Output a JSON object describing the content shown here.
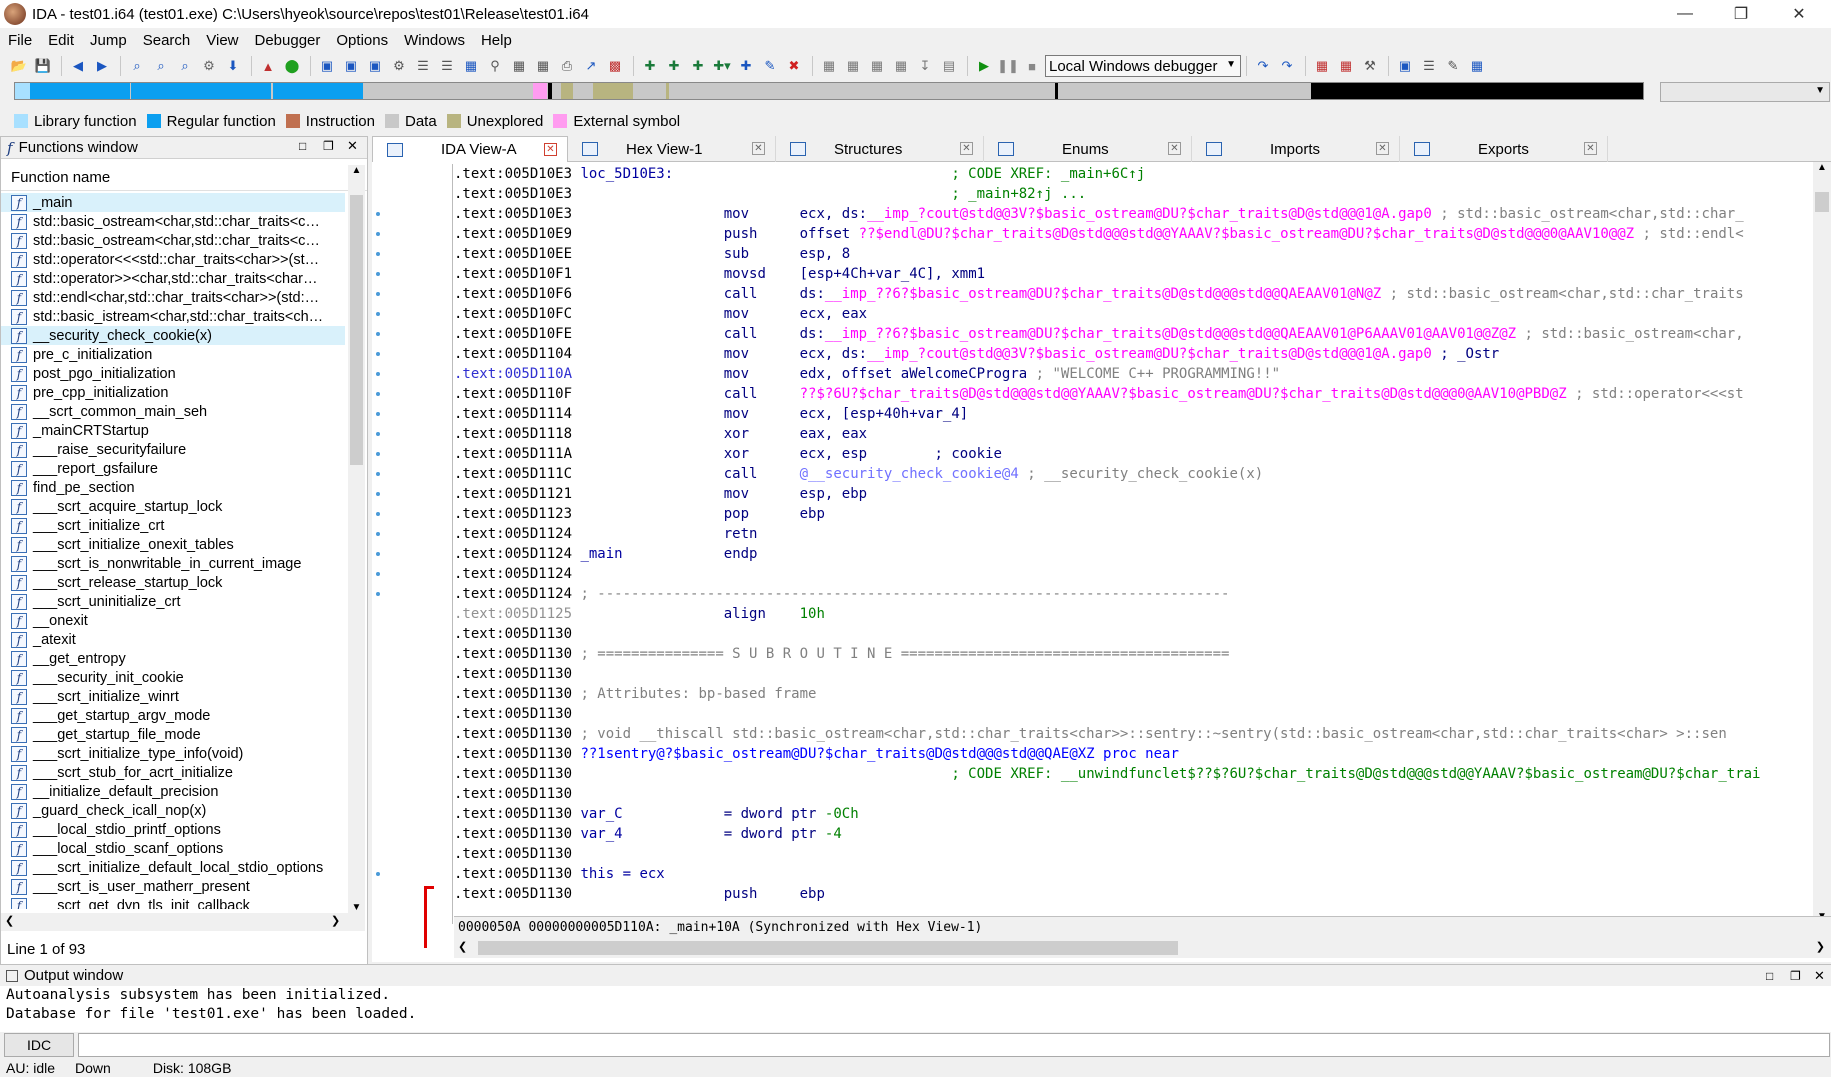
{
  "window": {
    "title": "IDA - test01.i64 (test01.exe) C:\\Users\\hyeok\\source\\repos\\test01\\Release\\test01.i64"
  },
  "menu": [
    "File",
    "Edit",
    "Jump",
    "Search",
    "View",
    "Debugger",
    "Options",
    "Windows",
    "Help"
  ],
  "toolbar": {
    "debugger_select": "Local Windows debugger"
  },
  "legend": [
    {
      "label": "Library function",
      "color": "#a8e0ff"
    },
    {
      "label": "Regular function",
      "color": "#0b9ff0"
    },
    {
      "label": "Instruction",
      "color": "#c07050"
    },
    {
      "label": "Data",
      "color": "#c8c8c8"
    },
    {
      "label": "Unexplored",
      "color": "#b8b480"
    },
    {
      "label": "External symbol",
      "color": "#ff9cf0"
    }
  ],
  "functions_window": {
    "title": "Functions window",
    "column": "Function name",
    "items": [
      "_main",
      "std::basic_ostream<char,std::char_traits<c…",
      "std::basic_ostream<char,std::char_traits<c…",
      "std::operator<<<std::char_traits<char>>(st…",
      "std::operator>><char,std::char_traits<char…",
      "std::endl<char,std::char_traits<char>>(std:…",
      "std::basic_istream<char,std::char_traits<ch…",
      "__security_check_cookie(x)",
      "pre_c_initialization",
      "post_pgo_initialization",
      "pre_cpp_initialization",
      "__scrt_common_main_seh",
      "_mainCRTStartup",
      "___raise_securityfailure",
      "___report_gsfailure",
      "find_pe_section",
      "___scrt_acquire_startup_lock",
      "___scrt_initialize_crt",
      "___scrt_initialize_onexit_tables",
      "___scrt_is_nonwritable_in_current_image",
      "___scrt_release_startup_lock",
      "___scrt_uninitialize_crt",
      "__onexit",
      "_atexit",
      "__get_entropy",
      "___security_init_cookie",
      "___scrt_initialize_winrt",
      "___get_startup_argv_mode",
      "___get_startup_file_mode",
      "___scrt_initialize_type_info(void)",
      "___scrt_stub_for_acrt_initialize",
      "__initialize_default_precision",
      "_guard_check_icall_nop(x)",
      "___local_stdio_printf_options",
      "___local_stdio_scanf_options",
      "___scrt_initialize_default_local_stdio_options",
      "___scrt_is_user_matherr_present",
      "___scrt_get_dyn_tls_init_callback"
    ],
    "status": "Line 1 of 93"
  },
  "tabs": [
    "IDA View-A",
    "Hex View-1",
    "Structures",
    "Enums",
    "Imports",
    "Exports"
  ],
  "code": [
    {
      "addr": ".text:005D10E3",
      "label": "loc_5D10E3:",
      "cmt": "; CODE XREF: _main+6C↑j"
    },
    {
      "addr": ".text:005D10E3",
      "cmt": "; _main+82↑j ..."
    },
    {
      "addr": ".text:005D10E3",
      "mn": "mov",
      "op": "ecx, ds:",
      "sym": "__imp_?cout@std@@3V?$basic_ostream@DU?$char_traits@D@std@@@1@A.gap0",
      "cmt2": " ; std::basic_ostream<char,std::char_"
    },
    {
      "addr": ".text:005D10E9",
      "mn": "push",
      "op": "offset ",
      "sym": "??$endl@DU?$char_traits@D@std@@@std@@YAAAV?$basic_ostream@DU?$char_traits@D@std@@@0@AAV10@@Z",
      "cmt2": " ; std::endl<"
    },
    {
      "addr": ".text:005D10EE",
      "mn": "sub",
      "op": "esp, 8"
    },
    {
      "addr": ".text:005D10F1",
      "mn": "movsd",
      "op": "[esp+4Ch+var_4C], xmm1"
    },
    {
      "addr": ".text:005D10F6",
      "mn": "call",
      "op": "ds:",
      "sym": "__imp_??6?$basic_ostream@DU?$char_traits@D@std@@@std@@QAEAAV01@N@Z",
      "cmt2": " ; std::basic_ostream<char,std::char_traits"
    },
    {
      "addr": ".text:005D10FC",
      "mn": "mov",
      "op": "ecx, eax"
    },
    {
      "addr": ".text:005D10FE",
      "mn": "call",
      "op": "ds:",
      "sym": "__imp_??6?$basic_ostream@DU?$char_traits@D@std@@@std@@QAEAAV01@P6AAAV01@AAV01@@Z@Z",
      "cmt2": " ; std::basic_ostream<char,"
    },
    {
      "addr": ".text:005D1104",
      "mn": "mov",
      "op": "ecx, ds:",
      "sym": "__imp_?cout@std@@3V?$basic_ostream@DU?$char_traits@D@std@@@1@A.gap0",
      "tail": " ; _Ostr"
    },
    {
      "addr": ".text:005D110A",
      "blue": true,
      "mn": "mov",
      "op": "edx, offset aWelcomeCProgra",
      "cmt2": " ; \"WELCOME C++ PROGRAMMING!!\""
    },
    {
      "addr": ".text:005D110F",
      "mn": "call",
      "sym": "??$?6U?$char_traits@D@std@@@std@@YAAAV?$basic_ostream@DU?$char_traits@D@std@@@0@AAV10@PBD@Z",
      "cmt2": " ; std::operator<<<st"
    },
    {
      "addr": ".text:005D1114",
      "mn": "mov",
      "op": "ecx, [esp+40h+var_4]"
    },
    {
      "addr": ".text:005D1118",
      "mn": "xor",
      "op": "eax, eax"
    },
    {
      "addr": ".text:005D111A",
      "mn": "xor",
      "op": "ecx, esp",
      "tail": "        ; cookie"
    },
    {
      "addr": ".text:005D111C",
      "mn": "call",
      "pu": "@__security_check_cookie@4",
      "cmt2": " ; __security_check_cookie(x)"
    },
    {
      "addr": ".text:005D1121",
      "mn": "mov",
      "op": "esp, ebp"
    },
    {
      "addr": ".text:005D1123",
      "mn": "pop",
      "op": "ebp"
    },
    {
      "addr": ".text:005D1124",
      "mn": "retn"
    },
    {
      "addr": ".text:005D1124",
      "label": "_main",
      "mn": "endp"
    },
    {
      "addr": ".text:005D1124"
    },
    {
      "addr": ".text:005D1124",
      "cmt": "; ---------------------------------------------------------------------------",
      "cmtleft": true
    },
    {
      "addr": ".text:005D1125",
      "grey": true,
      "mn": "align",
      "num": "10h"
    },
    {
      "addr": ".text:005D1130"
    },
    {
      "addr": ".text:005D1130",
      "cmt": "; =============== S U B R O U T I N E =======================================",
      "cmtleft": true
    },
    {
      "addr": ".text:005D1130"
    },
    {
      "addr": ".text:005D1130",
      "cmt": "; Attributes: bp-based frame",
      "cmtleft": true
    },
    {
      "addr": ".text:005D1130"
    },
    {
      "addr": ".text:005D1130",
      "cmt": "; void __thiscall std::basic_ostream<char,std::char_traits<char>>::sentry::~sentry(std::basic_ostream<char,std::char_traits<char> >::sen",
      "cmtleft": true
    },
    {
      "addr": ".text:005D1130",
      "label": "??1sentry@?$basic_ostream@DU?$char_traits@D@std@@@std@@QAE@XZ proc near"
    },
    {
      "addr": ".text:005D1130",
      "cmt": "; CODE XREF: ",
      "gsym": "__unwindfunclet$??$?6U?$char_traits@D@std@@@std@@YAAAV?$basic_ostream@DU?$char_trai"
    },
    {
      "addr": ".text:005D1130"
    },
    {
      "addr": ".text:005D1130",
      "label": "var_C",
      "mn": "= dword ptr",
      "num": "-0Ch"
    },
    {
      "addr": ".text:005D1130",
      "label": "var_4",
      "mn": "= dword ptr",
      "num": "-4"
    },
    {
      "addr": ".text:005D1130"
    },
    {
      "addr": ".text:005D1130",
      "label": "this = ecx"
    },
    {
      "addr": ".text:005D1130",
      "mn": "push",
      "op": "ebp"
    }
  ],
  "code_status": "0000050A 00000000005D110A: _main+10A (Synchronized with Hex View-1)",
  "output": {
    "title": "Output window",
    "lines": [
      "Autoanalysis subsystem has been initialized.",
      "Database for file 'test01.exe' has been loaded."
    ],
    "idc_label": "IDC"
  },
  "status": {
    "au": "AU:  idle",
    "dir": "Down",
    "disk": "Disk: 108GB"
  }
}
